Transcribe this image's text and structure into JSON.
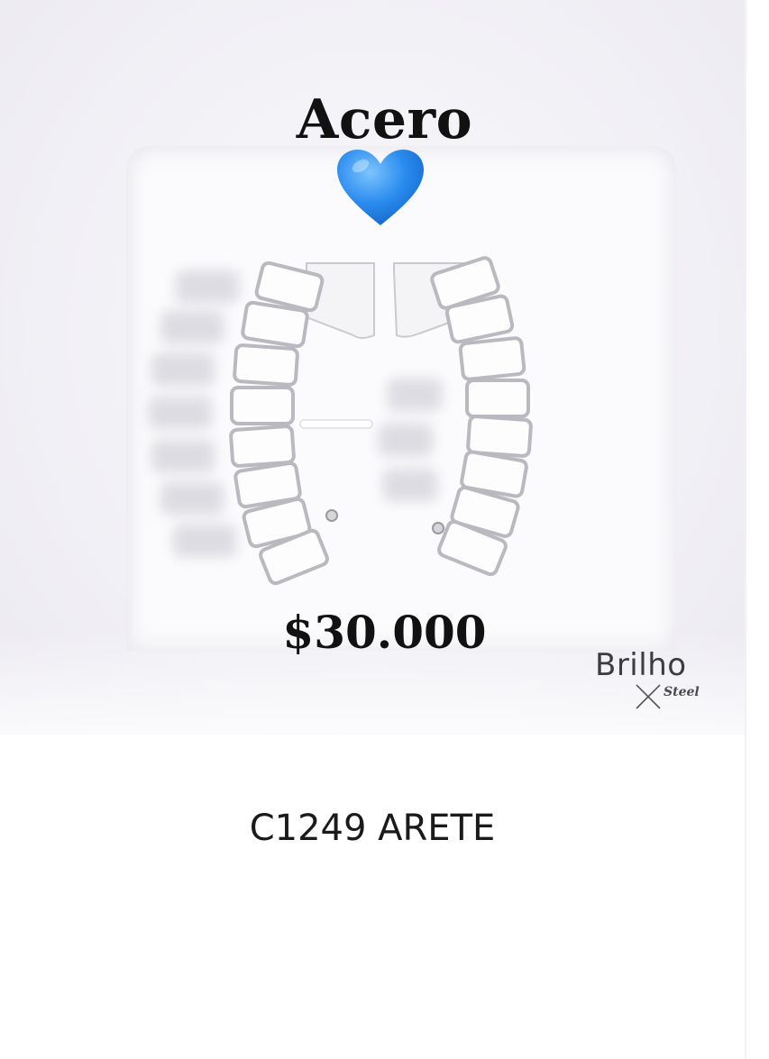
{
  "product_image": {
    "heading": "Acero",
    "heart_icon": "blue-heart",
    "price": "$30.000",
    "brand": {
      "name": "Brilho",
      "sub": "Steel"
    }
  },
  "product": {
    "name": "C1249 ARETE"
  },
  "colors": {
    "heart": "#2a8bee",
    "text": "#111111"
  }
}
